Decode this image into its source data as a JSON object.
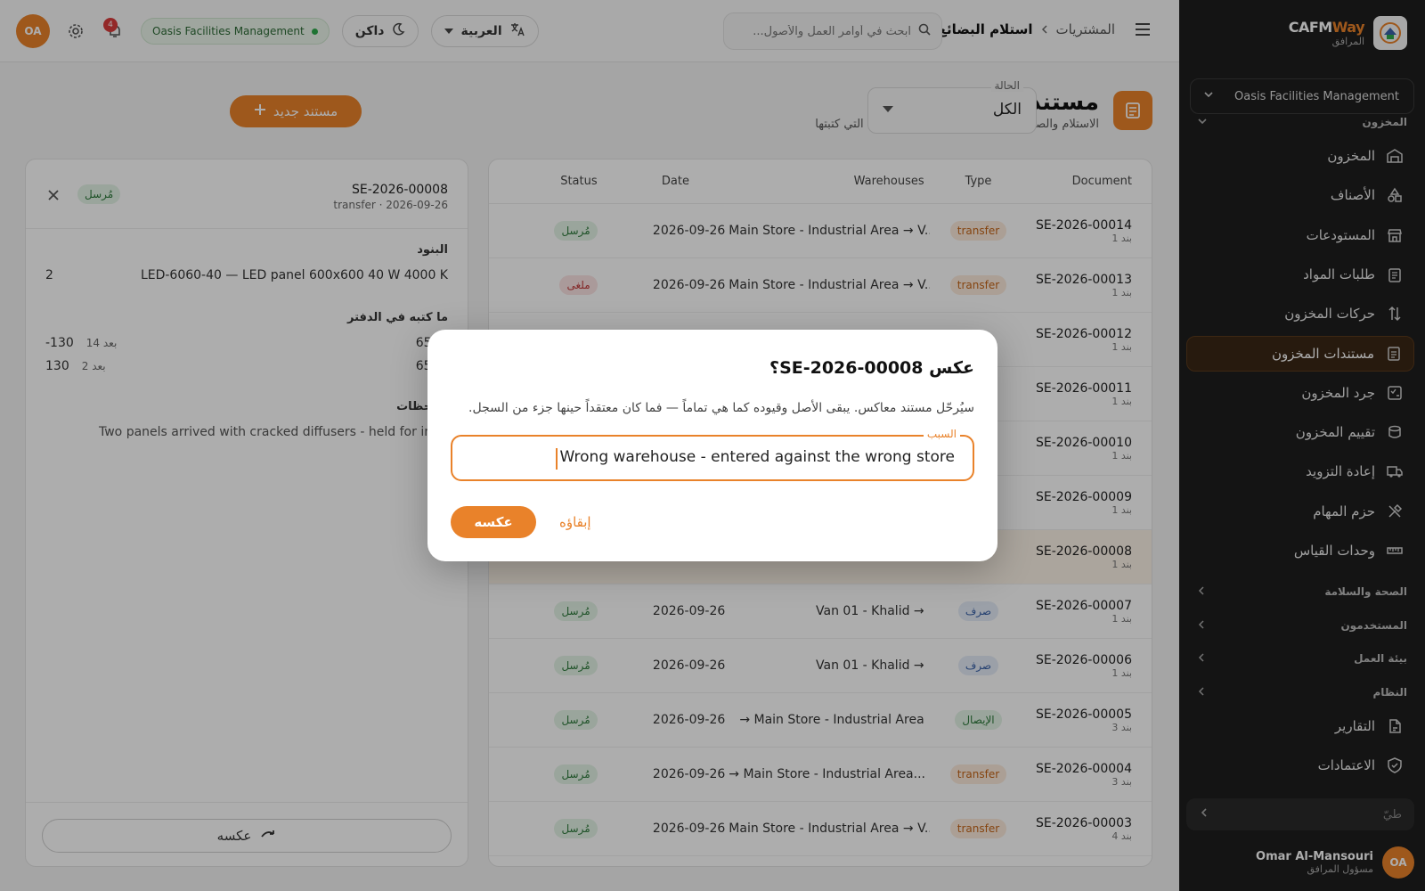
{
  "sidebar": {
    "brand_name_a": "CAFM",
    "brand_name_b": "Way",
    "brand_sub": "المرافق",
    "org_select": "Oasis Facilities Management",
    "group_partial": "المخزون",
    "items": [
      {
        "label": "المخزون",
        "icon": "warehouse-icon"
      },
      {
        "label": "الأصناف",
        "icon": "shapes-icon"
      },
      {
        "label": "المستودعات",
        "icon": "store-icon"
      },
      {
        "label": "طلبات المواد",
        "icon": "clipboard-icon"
      },
      {
        "label": "حركات المخزون",
        "icon": "arrows-updown-icon"
      },
      {
        "label": "مستندات المخزون",
        "icon": "document-icon",
        "active": true
      },
      {
        "label": "جرد المخزون",
        "icon": "checklist-icon"
      },
      {
        "label": "تقييم المخزون",
        "icon": "coins-icon"
      },
      {
        "label": "إعادة التزويد",
        "icon": "truck-icon"
      },
      {
        "label": "حزم المهام",
        "icon": "tools-icon"
      },
      {
        "label": "وحدات القياس",
        "icon": "ruler-icon"
      }
    ],
    "groups": [
      {
        "label": "الصحة والسلامة"
      },
      {
        "label": "المستخدمون"
      },
      {
        "label": "بيئة العمل"
      },
      {
        "label": "النظام"
      }
    ],
    "bottom_items": [
      {
        "label": "التقارير",
        "icon": "report-icon"
      },
      {
        "label": "الاعتمادات",
        "icon": "shield-check-icon"
      }
    ],
    "search_placeholder": "طيّ",
    "user": {
      "initials": "OA",
      "name": "Omar Al-Mansouri",
      "role": "مسؤول المرافق"
    }
  },
  "topbar": {
    "breadcrumb_parent": "المشتريات",
    "breadcrumb_current": "استلام البضائع",
    "search_placeholder": "ابحث في أوامر العمل والأصول...",
    "language": "العربية",
    "theme": "داكن",
    "org_chip": "Oasis Facilities Management",
    "notifications": "4",
    "avatar": "OA"
  },
  "page": {
    "title": "مستندات المخزون",
    "subtitle": "الاستلام والصرف والتحويل والتسويات — والقيود التي كتبتها",
    "filter_label": "الحالة",
    "filter_value": "الكل",
    "new_button": "مستند جديد"
  },
  "table": {
    "headers": {
      "document": "Document",
      "type": "Type",
      "warehouses": "Warehouses",
      "date": "Date",
      "status": "Status"
    },
    "rows": [
      {
        "doc": "SE-2026-00014",
        "lines": "1 بند",
        "type": "transfer",
        "type_color": "orange",
        "wh": "Main Store - Industrial Area → V...",
        "date": "2026-09-26",
        "status": "مُرسل",
        "status_color": "green"
      },
      {
        "doc": "SE-2026-00013",
        "lines": "1 بند",
        "type": "transfer",
        "type_color": "orange",
        "wh": "Main Store - Industrial Area → V...",
        "date": "2026-09-26",
        "status": "ملغى",
        "status_color": "red"
      },
      {
        "doc": "SE-2026-00012",
        "lines": "1 بند",
        "type": "",
        "type_color": "",
        "wh": "",
        "date": "",
        "status": "",
        "status_color": ""
      },
      {
        "doc": "SE-2026-00011",
        "lines": "1 بند",
        "type": "",
        "type_color": "",
        "wh": "",
        "date": "",
        "status": "",
        "status_color": ""
      },
      {
        "doc": "SE-2026-00010",
        "lines": "1 بند",
        "type": "",
        "type_color": "",
        "wh": "",
        "date": "",
        "status": "",
        "status_color": ""
      },
      {
        "doc": "SE-2026-00009",
        "lines": "1 بند",
        "type": "",
        "type_color": "",
        "wh": "",
        "date": "",
        "status": "",
        "status_color": ""
      },
      {
        "doc": "SE-2026-00008",
        "lines": "1 بند",
        "type": "",
        "type_color": "",
        "wh": "",
        "date": "",
        "status": "",
        "status_color": "",
        "selected": true
      },
      {
        "doc": "SE-2026-00007",
        "lines": "1 بند",
        "type": "صرف",
        "type_color": "blue",
        "wh": "Van 01 - Khalid →",
        "date": "2026-09-26",
        "status": "مُرسل",
        "status_color": "green"
      },
      {
        "doc": "SE-2026-00006",
        "lines": "1 بند",
        "type": "صرف",
        "type_color": "blue",
        "wh": "Van 01 - Khalid →",
        "date": "2026-09-26",
        "status": "مُرسل",
        "status_color": "green"
      },
      {
        "doc": "SE-2026-00005",
        "lines": "3 بند",
        "type": "الإيصال",
        "type_color": "green",
        "wh": "→ Main Store - Industrial Area",
        "date": "2026-09-26",
        "status": "مُرسل",
        "status_color": "green"
      },
      {
        "doc": "SE-2026-00004",
        "lines": "3 بند",
        "type": "transfer",
        "type_color": "orange",
        "wh": "→ Main Store - Industrial Area...",
        "date": "2026-09-26",
        "status": "مُرسل",
        "status_color": "green"
      },
      {
        "doc": "SE-2026-00003",
        "lines": "4 بند",
        "type": "transfer",
        "type_color": "orange",
        "wh": "Main Store - Industrial Area → V...",
        "date": "2026-09-26",
        "status": "مُرسل",
        "status_color": "green"
      }
    ]
  },
  "detail": {
    "doc_no": "SE-2026-00008",
    "meta": "transfer · 2026-09-26",
    "status": "مُرسل",
    "lines_title": "البنود",
    "line_item": "LED-6060-40 — LED panel 600x600 40 W 4000 K",
    "line_qty": "2",
    "ledger_title": "ما كتبه في الدفتر",
    "ledger": [
      {
        "rate": "65 @",
        "after": "بعد 14",
        "qty": "-130"
      },
      {
        "rate": "65 @",
        "after": "بعد 2",
        "qty": "130"
      }
    ],
    "notes_title": "ملاحظات",
    "notes": "Two panels arrived with cracked diffusers - held for inspection",
    "reverse_button": "عكسه"
  },
  "dialog": {
    "title": "عكس SE-2026-00008؟",
    "body": "سيُرحّل مستند معاكس. يبقى الأصل وقيوده كما هي تماماً — فما كان معتقداً حينها جزء من السجل.",
    "reason_label": "السبب",
    "reason_value": "Wrong warehouse - entered against the wrong store",
    "confirm": "عكسه",
    "cancel": "إبقاؤه"
  },
  "colors": {
    "accent": "#e9822a",
    "sidebar_bg": "#1e1e1e",
    "green": "#2d7a3b",
    "red": "#c23a3a",
    "blue": "#3a62a8"
  }
}
